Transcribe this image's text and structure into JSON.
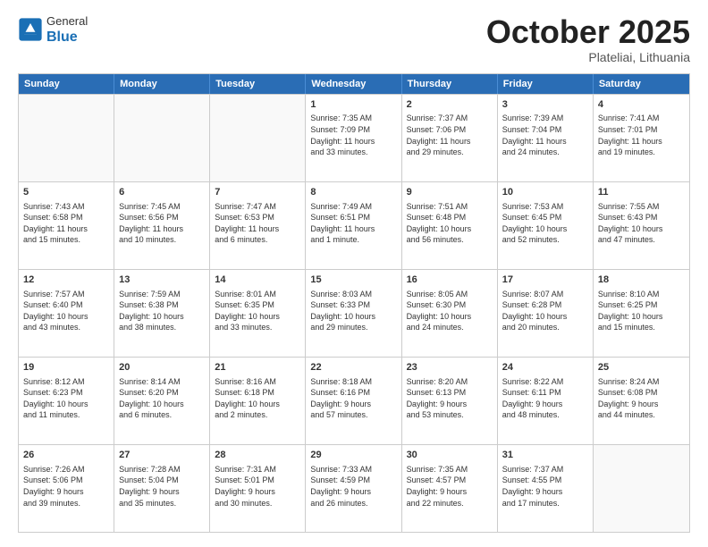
{
  "header": {
    "logo": {
      "general": "General",
      "blue": "Blue"
    },
    "title": "October 2025",
    "subtitle": "Plateliai, Lithuania"
  },
  "calendar": {
    "days_of_week": [
      "Sunday",
      "Monday",
      "Tuesday",
      "Wednesday",
      "Thursday",
      "Friday",
      "Saturday"
    ],
    "rows": [
      [
        {
          "day": "",
          "info": ""
        },
        {
          "day": "",
          "info": ""
        },
        {
          "day": "",
          "info": ""
        },
        {
          "day": "1",
          "info": "Sunrise: 7:35 AM\nSunset: 7:09 PM\nDaylight: 11 hours\nand 33 minutes."
        },
        {
          "day": "2",
          "info": "Sunrise: 7:37 AM\nSunset: 7:06 PM\nDaylight: 11 hours\nand 29 minutes."
        },
        {
          "day": "3",
          "info": "Sunrise: 7:39 AM\nSunset: 7:04 PM\nDaylight: 11 hours\nand 24 minutes."
        },
        {
          "day": "4",
          "info": "Sunrise: 7:41 AM\nSunset: 7:01 PM\nDaylight: 11 hours\nand 19 minutes."
        }
      ],
      [
        {
          "day": "5",
          "info": "Sunrise: 7:43 AM\nSunset: 6:58 PM\nDaylight: 11 hours\nand 15 minutes."
        },
        {
          "day": "6",
          "info": "Sunrise: 7:45 AM\nSunset: 6:56 PM\nDaylight: 11 hours\nand 10 minutes."
        },
        {
          "day": "7",
          "info": "Sunrise: 7:47 AM\nSunset: 6:53 PM\nDaylight: 11 hours\nand 6 minutes."
        },
        {
          "day": "8",
          "info": "Sunrise: 7:49 AM\nSunset: 6:51 PM\nDaylight: 11 hours\nand 1 minute."
        },
        {
          "day": "9",
          "info": "Sunrise: 7:51 AM\nSunset: 6:48 PM\nDaylight: 10 hours\nand 56 minutes."
        },
        {
          "day": "10",
          "info": "Sunrise: 7:53 AM\nSunset: 6:45 PM\nDaylight: 10 hours\nand 52 minutes."
        },
        {
          "day": "11",
          "info": "Sunrise: 7:55 AM\nSunset: 6:43 PM\nDaylight: 10 hours\nand 47 minutes."
        }
      ],
      [
        {
          "day": "12",
          "info": "Sunrise: 7:57 AM\nSunset: 6:40 PM\nDaylight: 10 hours\nand 43 minutes."
        },
        {
          "day": "13",
          "info": "Sunrise: 7:59 AM\nSunset: 6:38 PM\nDaylight: 10 hours\nand 38 minutes."
        },
        {
          "day": "14",
          "info": "Sunrise: 8:01 AM\nSunset: 6:35 PM\nDaylight: 10 hours\nand 33 minutes."
        },
        {
          "day": "15",
          "info": "Sunrise: 8:03 AM\nSunset: 6:33 PM\nDaylight: 10 hours\nand 29 minutes."
        },
        {
          "day": "16",
          "info": "Sunrise: 8:05 AM\nSunset: 6:30 PM\nDaylight: 10 hours\nand 24 minutes."
        },
        {
          "day": "17",
          "info": "Sunrise: 8:07 AM\nSunset: 6:28 PM\nDaylight: 10 hours\nand 20 minutes."
        },
        {
          "day": "18",
          "info": "Sunrise: 8:10 AM\nSunset: 6:25 PM\nDaylight: 10 hours\nand 15 minutes."
        }
      ],
      [
        {
          "day": "19",
          "info": "Sunrise: 8:12 AM\nSunset: 6:23 PM\nDaylight: 10 hours\nand 11 minutes."
        },
        {
          "day": "20",
          "info": "Sunrise: 8:14 AM\nSunset: 6:20 PM\nDaylight: 10 hours\nand 6 minutes."
        },
        {
          "day": "21",
          "info": "Sunrise: 8:16 AM\nSunset: 6:18 PM\nDaylight: 10 hours\nand 2 minutes."
        },
        {
          "day": "22",
          "info": "Sunrise: 8:18 AM\nSunset: 6:16 PM\nDaylight: 9 hours\nand 57 minutes."
        },
        {
          "day": "23",
          "info": "Sunrise: 8:20 AM\nSunset: 6:13 PM\nDaylight: 9 hours\nand 53 minutes."
        },
        {
          "day": "24",
          "info": "Sunrise: 8:22 AM\nSunset: 6:11 PM\nDaylight: 9 hours\nand 48 minutes."
        },
        {
          "day": "25",
          "info": "Sunrise: 8:24 AM\nSunset: 6:08 PM\nDaylight: 9 hours\nand 44 minutes."
        }
      ],
      [
        {
          "day": "26",
          "info": "Sunrise: 7:26 AM\nSunset: 5:06 PM\nDaylight: 9 hours\nand 39 minutes."
        },
        {
          "day": "27",
          "info": "Sunrise: 7:28 AM\nSunset: 5:04 PM\nDaylight: 9 hours\nand 35 minutes."
        },
        {
          "day": "28",
          "info": "Sunrise: 7:31 AM\nSunset: 5:01 PM\nDaylight: 9 hours\nand 30 minutes."
        },
        {
          "day": "29",
          "info": "Sunrise: 7:33 AM\nSunset: 4:59 PM\nDaylight: 9 hours\nand 26 minutes."
        },
        {
          "day": "30",
          "info": "Sunrise: 7:35 AM\nSunset: 4:57 PM\nDaylight: 9 hours\nand 22 minutes."
        },
        {
          "day": "31",
          "info": "Sunrise: 7:37 AM\nSunset: 4:55 PM\nDaylight: 9 hours\nand 17 minutes."
        },
        {
          "day": "",
          "info": ""
        }
      ]
    ]
  }
}
